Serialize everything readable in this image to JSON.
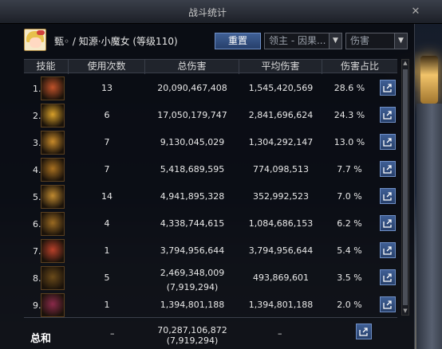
{
  "window": {
    "title": "战斗统计"
  },
  "character": {
    "name": "甄◦ / 知源·小魔女 (等级110)"
  },
  "controls": {
    "reset_label": "重置",
    "filter1_value": "领主 - 因果...",
    "filter2_value": "伤害"
  },
  "columns": [
    "技能",
    "使用次数",
    "总伤害",
    "平均伤害",
    "伤害占比"
  ],
  "rows": [
    {
      "rank": "1.",
      "uses": "13",
      "total": "20,090,467,408",
      "avg": "1,545,420,569",
      "pct": "28.6 %",
      "icon_color": "#c0522a"
    },
    {
      "rank": "2.",
      "uses": "6",
      "total": "17,050,179,747",
      "avg": "2,841,696,624",
      "pct": "24.3 %",
      "icon_color": "#d8a02a"
    },
    {
      "rank": "3.",
      "uses": "7",
      "total": "9,130,045,029",
      "avg": "1,304,292,147",
      "pct": "13.0 %",
      "icon_color": "#c88a2a"
    },
    {
      "rank": "4.",
      "uses": "7",
      "total": "5,418,689,595",
      "avg": "774,098,513",
      "pct": "7.7 %",
      "icon_color": "#a87020"
    },
    {
      "rank": "5.",
      "uses": "14",
      "total": "4,941,895,328",
      "avg": "352,992,523",
      "pct": "7.0 %",
      "icon_color": "#c08a30"
    },
    {
      "rank": "6.",
      "uses": "4",
      "total": "4,338,744,615",
      "avg": "1,084,686,153",
      "pct": "6.2 %",
      "icon_color": "#9a6a22"
    },
    {
      "rank": "7.",
      "uses": "1",
      "total": "3,794,956,644",
      "avg": "3,794,956,644",
      "pct": "5.4 %",
      "icon_color": "#b8402a"
    },
    {
      "rank": "8.",
      "uses": "5",
      "total": "2,469,348,009",
      "total_sub": "(7,919,294)",
      "avg": "493,869,601",
      "pct": "3.5 %",
      "icon_color": "#6a4a1a"
    },
    {
      "rank": "9.",
      "uses": "1",
      "total": "1,394,801,188",
      "avg": "1,394,801,188",
      "pct": "2.0 %",
      "icon_color": "#8a2a4a"
    }
  ],
  "totals": {
    "label": "总和",
    "uses": "–",
    "total": "70,287,106,872",
    "total_sub": "(7,919,294)",
    "avg": "–"
  }
}
